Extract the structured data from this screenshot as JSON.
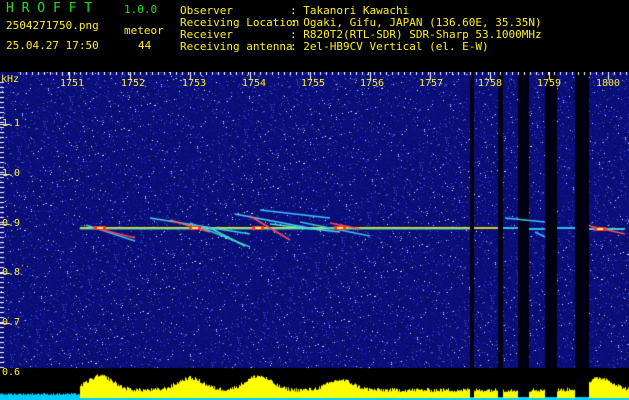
{
  "header": {
    "app_name": "H R O F F T",
    "version": "1.0.0",
    "file_name": "2504271750.png",
    "mode_label": "meteor",
    "date_time": "25.04.27 17:50",
    "meteor_count": "44",
    "labels": {
      "observer": "Observer",
      "location": "Receiving Location",
      "receiver": "Receiver",
      "antenna": "Receiving antenna"
    },
    "values": {
      "observer": ": Takanori Kawachi",
      "location": ": Ogaki, Gifu, JAPAN (136.60E, 35.35N)",
      "receiver": ": R820T2(RTL-SDR) SDR-Sharp 53.1000MHz",
      "antenna": ": 2el-HB9CV Vertical (el. E-W)"
    }
  },
  "axes": {
    "y_unit": "kHz",
    "time_labels": [
      "1751",
      "1752",
      "1753",
      "1754",
      "1755",
      "1756",
      "1757",
      "1758",
      "1759",
      "1800"
    ],
    "freq_labels": [
      "1.1",
      "1.0",
      "0.9",
      "0.8",
      "0.7",
      "0.6"
    ]
  },
  "colors": {
    "background": "#000000",
    "noise": "#1a1f8a",
    "header_green": "#22dd22",
    "header_yellow": "#ffee22",
    "signal_line": "#ffee22",
    "meteor_trail": "#ff5050",
    "level_fill": "#ffff00",
    "level_base": "#00ccff"
  }
}
